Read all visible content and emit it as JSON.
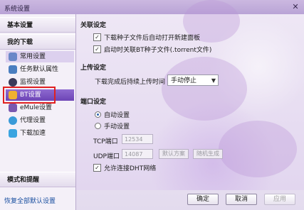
{
  "window": {
    "title": "系统设置",
    "close": "✕"
  },
  "sidebar": {
    "basic_settings": "基本设置",
    "my_downloads": "我的下载",
    "items": [
      {
        "label": "常用设置",
        "icon": "gear-icon"
      },
      {
        "label": "任务默认属性",
        "icon": "task-icon"
      },
      {
        "label": "监视设置",
        "icon": "monitor-icon"
      },
      {
        "label": "BT设置",
        "icon": "folder-icon"
      },
      {
        "label": "eMule设置",
        "icon": "emule-icon"
      },
      {
        "label": "代理设置",
        "icon": "globe-icon"
      },
      {
        "label": "下载加速",
        "icon": "lightning-icon"
      }
    ],
    "selected": "BT设置",
    "mode_and_reminder": "模式和提醒",
    "restore_defaults": "恢复全部默认设置"
  },
  "association": {
    "title": "关联设定",
    "option1": "下载种子文件后自动打开新建面板",
    "option1_checked": true,
    "option2": "启动时关联BT种子文件(.torrent文件)",
    "option2_checked": true
  },
  "upload": {
    "title": "上传设定",
    "label": "下载完成后持续上传时间",
    "value": "手动停止"
  },
  "port": {
    "title": "端口设定",
    "auto": "自动设置",
    "manual": "手动设置",
    "tcp_label": "TCP端口",
    "tcp_value": "12534",
    "udp_label": "UDP端口",
    "udp_value": "14087",
    "default_scheme": "默认方案",
    "random_generate": "随机生成",
    "dht_label": "允许连接DHT网络",
    "dht_checked": true
  },
  "buttons": {
    "ok": "确定",
    "cancel": "取消",
    "apply": "应用"
  }
}
